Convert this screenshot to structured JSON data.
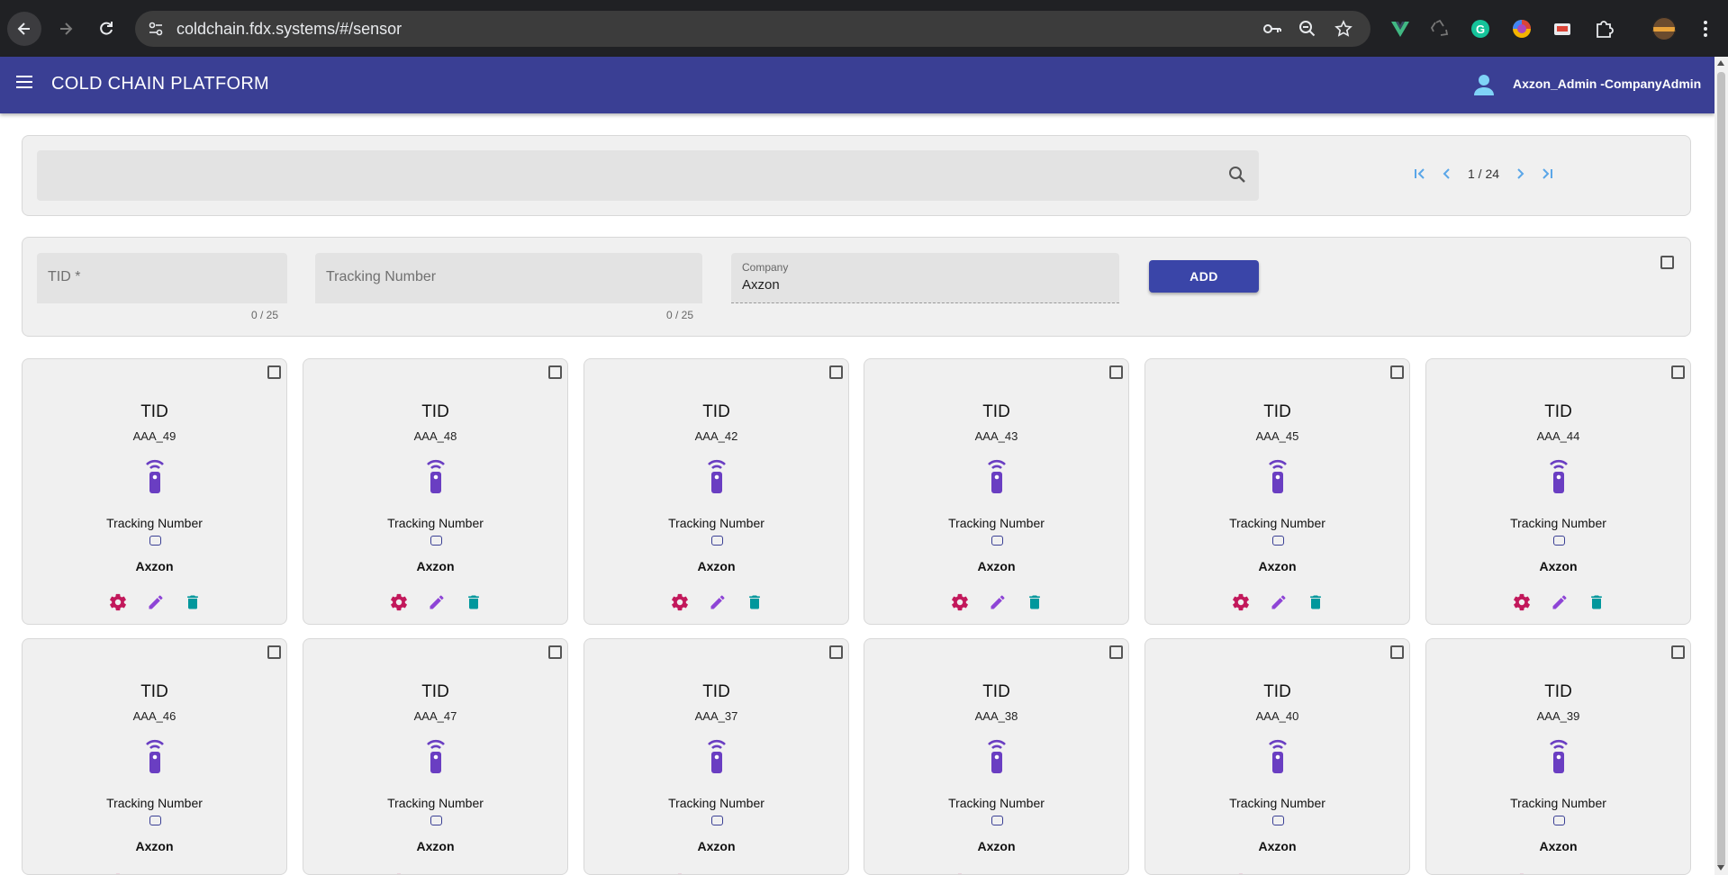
{
  "browser": {
    "url": "coldchain.fdx.systems/#/sensor"
  },
  "app": {
    "title": "COLD CHAIN PLATFORM",
    "user": "Axzon_Admin -CompanyAdmin"
  },
  "search": {
    "placeholder": ""
  },
  "pagination": {
    "text": "1 / 24"
  },
  "form": {
    "tid_placeholder": "TID *",
    "tid_counter": "0 / 25",
    "tracking_placeholder": "Tracking Number",
    "tracking_counter": "0 / 25",
    "company_label": "Company",
    "company_value": "Axzon",
    "add_label": "ADD"
  },
  "cards": [
    {
      "title": "TID",
      "tid": "AAA_49",
      "tracking_label": "Tracking Number",
      "company": "Axzon"
    },
    {
      "title": "TID",
      "tid": "AAA_48",
      "tracking_label": "Tracking Number",
      "company": "Axzon"
    },
    {
      "title": "TID",
      "tid": "AAA_42",
      "tracking_label": "Tracking Number",
      "company": "Axzon"
    },
    {
      "title": "TID",
      "tid": "AAA_43",
      "tracking_label": "Tracking Number",
      "company": "Axzon"
    },
    {
      "title": "TID",
      "tid": "AAA_45",
      "tracking_label": "Tracking Number",
      "company": "Axzon"
    },
    {
      "title": "TID",
      "tid": "AAA_44",
      "tracking_label": "Tracking Number",
      "company": "Axzon"
    },
    {
      "title": "TID",
      "tid": "AAA_46",
      "tracking_label": "Tracking Number",
      "company": "Axzon"
    },
    {
      "title": "TID",
      "tid": "AAA_47",
      "tracking_label": "Tracking Number",
      "company": "Axzon"
    },
    {
      "title": "TID",
      "tid": "AAA_37",
      "tracking_label": "Tracking Number",
      "company": "Axzon"
    },
    {
      "title": "TID",
      "tid": "AAA_38",
      "tracking_label": "Tracking Number",
      "company": "Axzon"
    },
    {
      "title": "TID",
      "tid": "AAA_40",
      "tracking_label": "Tracking Number",
      "company": "Axzon"
    },
    {
      "title": "TID",
      "tid": "AAA_39",
      "tracking_label": "Tracking Number",
      "company": "Axzon"
    }
  ],
  "card_actions": [
    "settings-icon",
    "edit-icon",
    "delete-icon"
  ],
  "colors": {
    "appbar": "#3a3f94",
    "sensor_icon": "#6a3ec2",
    "settings_icon": "#c2185b",
    "edit_icon": "#8e44d6",
    "delete_icon": "#00979c",
    "pager_icon": "#5aa6e8"
  }
}
